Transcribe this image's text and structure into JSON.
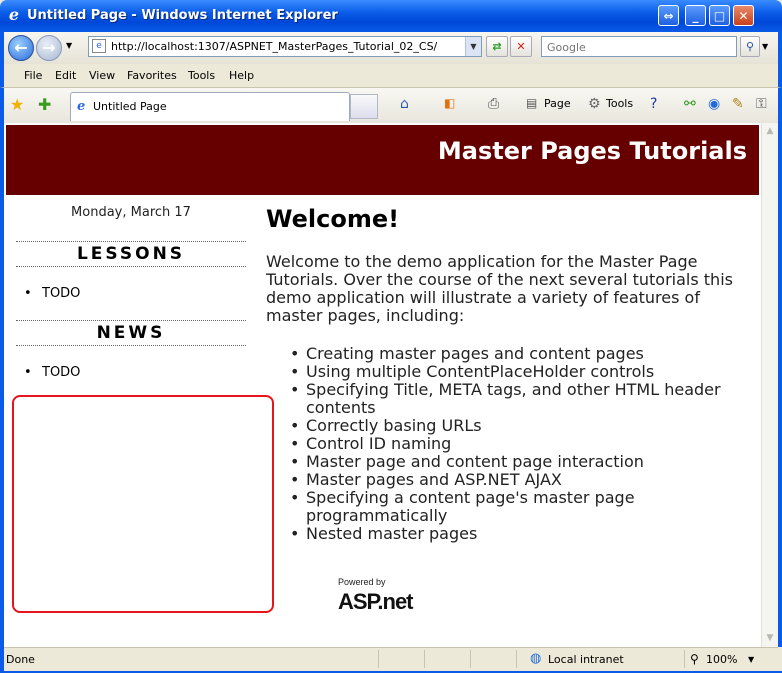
{
  "window": {
    "title": "Untitled Page - Windows Internet Explorer",
    "min_glyph": "_",
    "max_glyph": "□",
    "close_glyph": "✕"
  },
  "navbar": {
    "url": "http://localhost:1307/ASPNET_MasterPages_Tutorial_02_CS/",
    "search_placeholder": "Google"
  },
  "menu": {
    "items": [
      "File",
      "Edit",
      "View",
      "Favorites",
      "Tools",
      "Help"
    ]
  },
  "tabs": {
    "active_tab_label": "Untitled Page"
  },
  "command_bar": {
    "page_label": "Page",
    "tools_label": "Tools"
  },
  "page": {
    "header_title": "Master Pages Tutorials",
    "date": "Monday, March 17",
    "lessons_heading": "LESSONS",
    "lessons_items": [
      "TODO"
    ],
    "news_heading": "NEWS",
    "news_items": [
      "TODO"
    ],
    "welcome_heading": "Welcome!",
    "intro": "Welcome to the demo application for the Master Page Tutorials. Over the course of the next several tutorials this demo application will illustrate a variety of features of master pages, including:",
    "features": [
      " Creating master pages and content pages",
      "Using multiple ContentPlaceHolder controls",
      "Specifying Title, META tags, and other HTML header contents",
      "Correctly basing URLs",
      "Control ID naming",
      "Master page and content page interaction",
      "Master pages and ASP.NET AJAX",
      "Specifying a content page's master page programmatically",
      "Nested master pages"
    ],
    "powered_by": "Powered by",
    "asp_logo_text": "ASP.net"
  },
  "statusbar": {
    "status": "Done",
    "zone": "Local intranet",
    "zoom": "100%"
  },
  "colors": {
    "header_bg": "#660000",
    "highlight_border": "#e8141c",
    "xp_blue": "#0a5ce8"
  }
}
